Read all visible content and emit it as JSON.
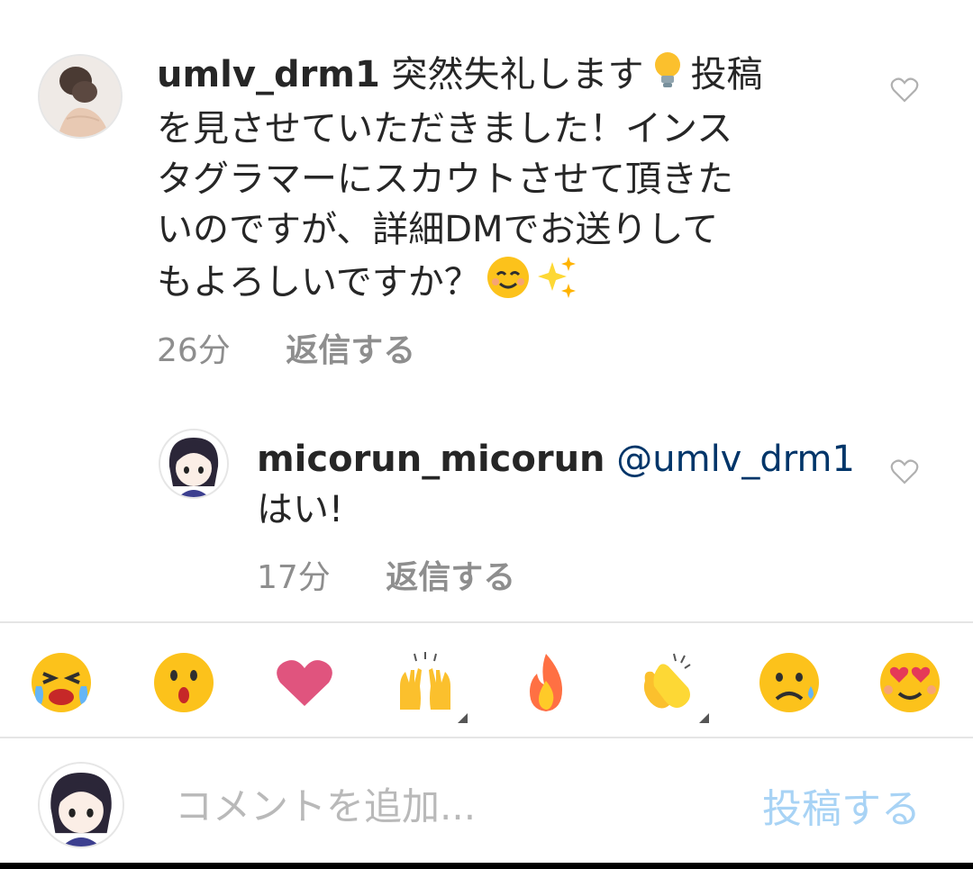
{
  "comments": [
    {
      "username": "umlv_drm1",
      "text_line1": "突然失礼します",
      "text_line1b": "投稿",
      "text_line2": "を見させていただきました！インス",
      "text_line3": "タグラマーにスカウトさせて頂きた",
      "text_line4": "いのですが、詳細DMでお送りして",
      "text_line5": "もよろしいですか？",
      "time": "26分",
      "reply_label": "返信する"
    },
    {
      "username": "micorun_micorun",
      "mention": "@umlv_drm1",
      "text": "はい!",
      "time": "17分",
      "reply_label": "返信する"
    }
  ],
  "emoji_bar": [
    "crying-face",
    "surprised-face",
    "heart",
    "raised-hands",
    "fire",
    "clapping-hands",
    "sad-sweat-face",
    "heart-eyes-face"
  ],
  "composer": {
    "placeholder": "コメントを追加...",
    "post_label": "投稿する"
  },
  "colors": {
    "mention": "#003569",
    "meta_gray": "#8e8e8e",
    "post_disabled": "#a8d3f5"
  }
}
